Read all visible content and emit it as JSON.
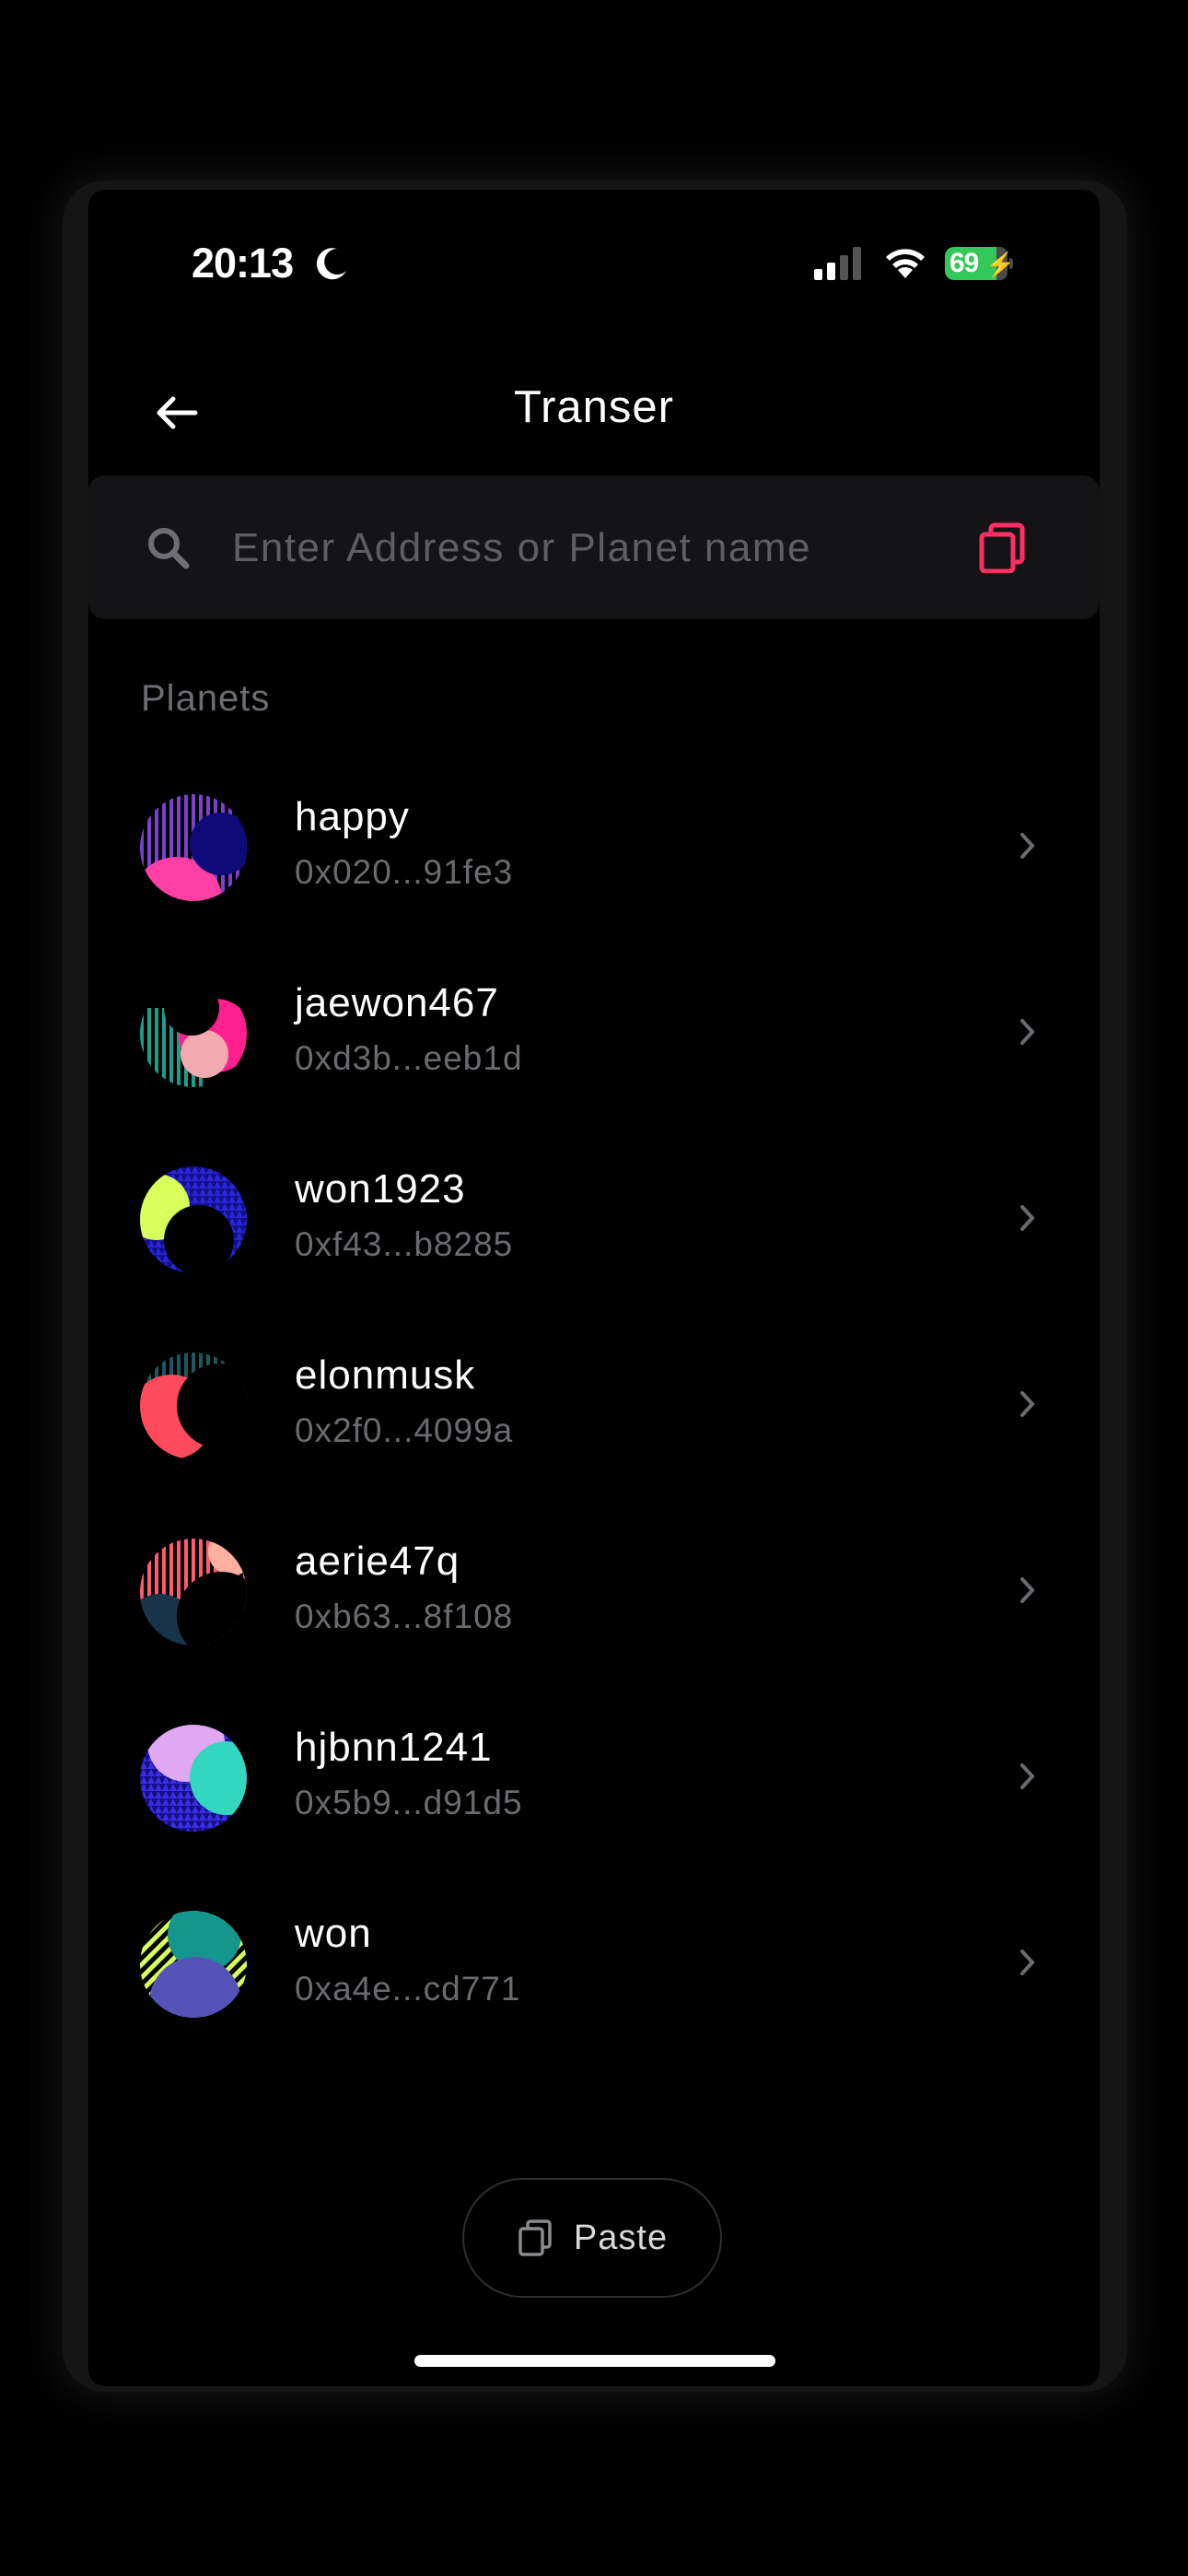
{
  "status_bar": {
    "time": "20:13",
    "battery": "69",
    "icons": [
      "moon-icon",
      "cellular-signal-icon",
      "wifi-icon",
      "battery-icon"
    ]
  },
  "header": {
    "title": "Transer",
    "back_icon": "arrow-left-icon"
  },
  "search": {
    "placeholder": "Enter Address or Planet name",
    "value": "",
    "search_icon": "search-icon",
    "copy_icon": "copy-icon"
  },
  "planets": {
    "section_label": "Planets",
    "items": [
      {
        "name": "happy",
        "address": "0x020...91fe3",
        "avatar": "planet-avatar-happy"
      },
      {
        "name": "jaewon467",
        "address": "0xd3b...eeb1d",
        "avatar": "planet-avatar-jaewon467"
      },
      {
        "name": "won1923",
        "address": "0xf43...b8285",
        "avatar": "planet-avatar-won1923"
      },
      {
        "name": "elonmusk",
        "address": "0x2f0...4099a",
        "avatar": "planet-avatar-elonmusk"
      },
      {
        "name": "aerie47q",
        "address": "0xb63...8f108",
        "avatar": "planet-avatar-aerie47q"
      },
      {
        "name": "hjbnn1241",
        "address": "0x5b9...d91d5",
        "avatar": "planet-avatar-hjbnn1241"
      },
      {
        "name": "won",
        "address": "0xa4e...cd771",
        "avatar": "planet-avatar-won"
      }
    ]
  },
  "paste_button": {
    "label": "Paste",
    "icon": "paste-icon"
  },
  "colors": {
    "accent": "#ff2e63",
    "background": "#000000",
    "search_bg": "#141417",
    "muted_text": "#6a6a70"
  }
}
